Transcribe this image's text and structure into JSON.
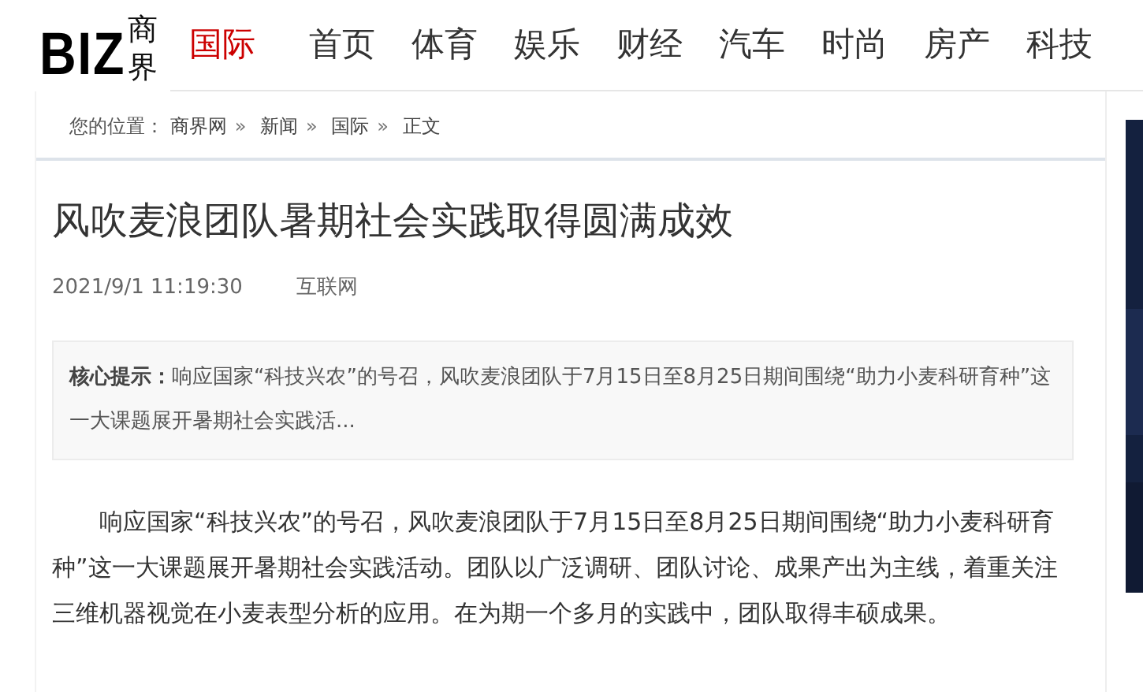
{
  "logo": {
    "mark": "BIZ",
    "name": "商界"
  },
  "nav": [
    {
      "label": "国际",
      "selected": true
    },
    {
      "label": "首页",
      "selected": false
    },
    {
      "label": "体育",
      "selected": false
    },
    {
      "label": "娱乐",
      "selected": false
    },
    {
      "label": "财经",
      "selected": false
    },
    {
      "label": "汽车",
      "selected": false
    },
    {
      "label": "时尚",
      "selected": false
    },
    {
      "label": "房产",
      "selected": false
    },
    {
      "label": "科技",
      "selected": false
    }
  ],
  "breadcrumb": {
    "prefix": "您的位置：",
    "items": [
      "商界网",
      "新闻",
      "国际",
      "正文"
    ],
    "separator": "»"
  },
  "article": {
    "title": "风吹麦浪团队暑期社会实践取得圆满成效",
    "date": "2021/9/1 11:19:30",
    "source": "互联网",
    "summary": {
      "label": "核心提示：",
      "text": "响应国家“科技兴农”的号召，风吹麦浪团队于7月15日至8月25日期间围绕“助力小麦科研育种”这一大课题展开暑期社会实践活..."
    },
    "paragraphs": [
      "响应国家“科技兴农”的号召，风吹麦浪团队于7月15日至8月25日期间围绕“助力小麦科研育种”这一大课题展开暑期社会实践活动。团队以广泛调研、团队讨论、成果产出为主线，着重关注三维机器视觉在小麦表型分析的应用。在为期一个多月的实践中，团队取得丰硕成果。"
    ]
  }
}
